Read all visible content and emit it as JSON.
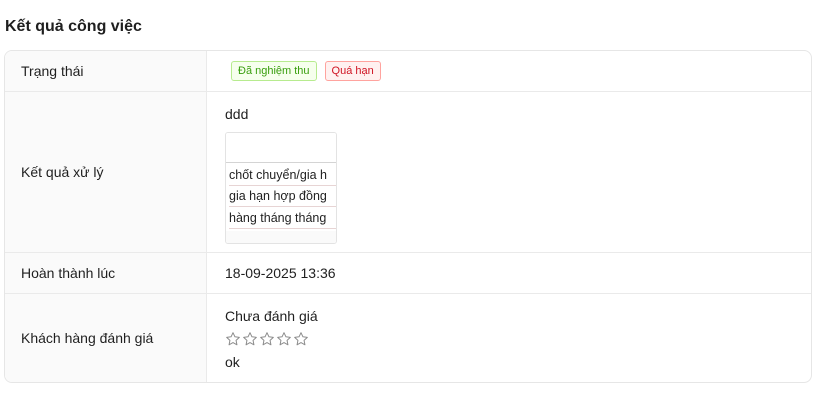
{
  "section": {
    "title": "Kết quả công việc"
  },
  "rows": {
    "status": {
      "label": "Trạng thái",
      "tags": [
        "Đã nghiệm thu",
        "Quá hạn"
      ]
    },
    "result": {
      "label": "Kết quả xử lý",
      "text": "ddd",
      "attachment_lines": [
        "chốt chuyển/gia h",
        "gia hạn hợp đồng",
        "hàng tháng tháng"
      ]
    },
    "completed": {
      "label": "Hoàn thành lúc",
      "value": "18-09-2025 13:36"
    },
    "review": {
      "label": "Khách hàng đánh giá",
      "rating_text": "Chưa đánh giá",
      "rating_value": 0,
      "rating_max": 5,
      "comment": "ok"
    }
  },
  "colors": {
    "tag_green": "#389e0d",
    "tag_red": "#cf1322",
    "label_bg": "#fafafa",
    "star_outline": "#8c8c8c"
  }
}
